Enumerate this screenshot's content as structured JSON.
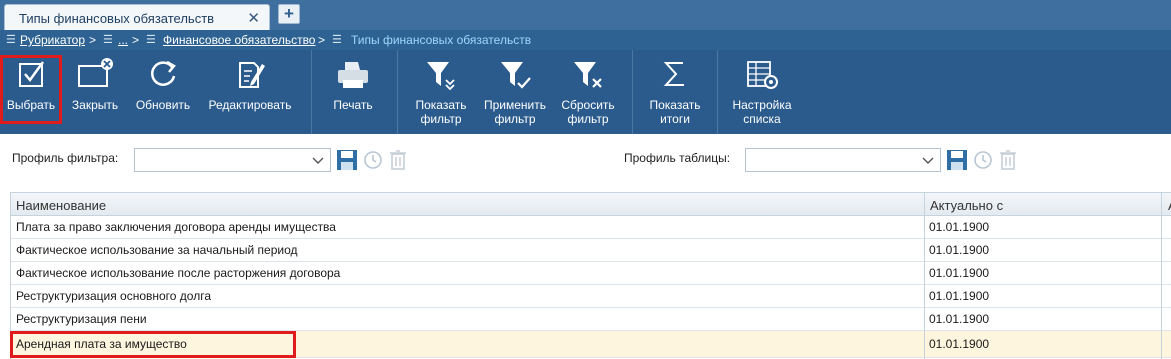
{
  "tab": {
    "title": "Типы финансовых обязательств",
    "close": "✕",
    "add": "+"
  },
  "breadcrumb": {
    "items": [
      "Рубрикатор",
      "...",
      "Финансовое обязательство"
    ],
    "current": "Типы финансовых обязательств",
    "separator": ">"
  },
  "toolbar": {
    "buttons": [
      {
        "icon": "checkbox-icon",
        "label": "Выбрать"
      },
      {
        "icon": "close-window-icon",
        "label": "Закрыть"
      },
      {
        "icon": "refresh-icon",
        "label": "Обновить"
      },
      {
        "icon": "edit-icon",
        "label": "Редактировать"
      },
      {
        "icon": "print-icon",
        "label": "Печать"
      },
      {
        "icon": "filter-show-icon",
        "label": "Показать\nфильтр"
      },
      {
        "icon": "filter-apply-icon",
        "label": "Применить\nфильтр"
      },
      {
        "icon": "filter-reset-icon",
        "label": "Сбросить\nфильтр"
      },
      {
        "icon": "sigma-icon",
        "label": "Показать\nитоги"
      },
      {
        "icon": "list-settings-icon",
        "label": "Настройка\nсписка"
      }
    ]
  },
  "filters": {
    "filter_profile_label": "Профиль фильтра:",
    "filter_profile_value": "",
    "table_profile_label": "Профиль таблицы:",
    "table_profile_value": ""
  },
  "table": {
    "columns": [
      "Наименование",
      "Актуально с",
      "А"
    ],
    "rows": [
      {
        "name": "Плата за право заключения договора аренды имущества",
        "date": "01.01.1900"
      },
      {
        "name": "Фактическое использование за начальный период",
        "date": "01.01.1900"
      },
      {
        "name": "Фактическое использование после расторжения договора",
        "date": "01.01.1900"
      },
      {
        "name": "Реструктуризация основного долга",
        "date": "01.01.1900"
      },
      {
        "name": "Реструктуризация пени",
        "date": "01.01.1900"
      },
      {
        "name": "Арендная плата за имущество",
        "date": "01.01.1900",
        "selected": true
      }
    ]
  },
  "colors": {
    "toolbar": "#2a5b8c",
    "breadcrumb": "#2d6292",
    "highlight": "#e01b1b",
    "selected_row": "#fdf5dd"
  }
}
